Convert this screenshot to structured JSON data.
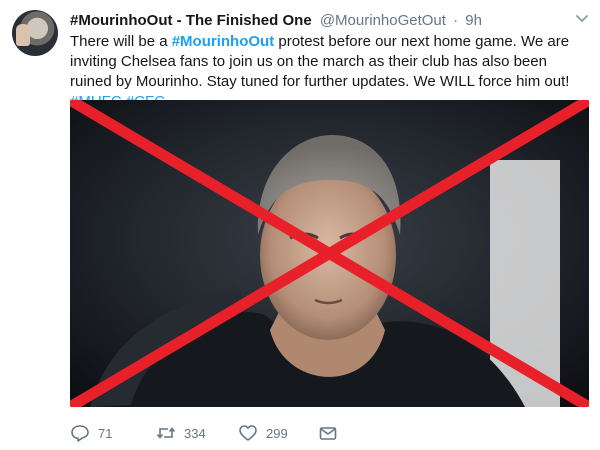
{
  "tweet": {
    "display_name": "#MourinhoOut - The Finished One",
    "handle": "@MourinhoGetOut",
    "separator": "·",
    "time": "9h",
    "text": {
      "part1": "There will be a ",
      "hashtag1": "#MourinhoOut",
      "part2": " protest before our next home game. We are inviting Chelsea fans to join us on the march as their club has also been ruined by Mourinho. Stay tuned for further updates. We WILL force him out! ",
      "hashtag2": "#MUFC",
      "hashtag3": "#CFC"
    },
    "media_icon": "red-x-cross-over-photo",
    "actions": {
      "reply_count": "71",
      "retweet_count": "334",
      "like_count": "299"
    },
    "colors": {
      "link": "#1da1f2",
      "secondary": "#657786",
      "cross": "#e8202a"
    }
  }
}
